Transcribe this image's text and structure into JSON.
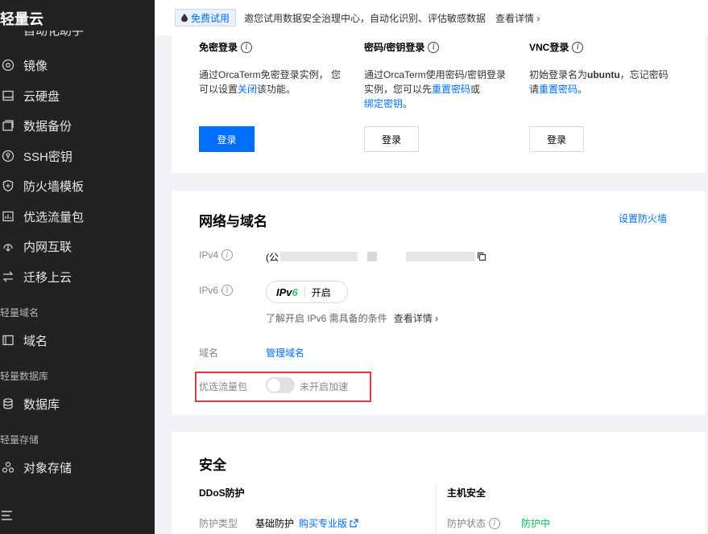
{
  "sidebar": {
    "brand": "轻量云",
    "cut_item": "自动化助手",
    "items": [
      {
        "label": "镜像",
        "icon": "image-icon"
      },
      {
        "label": "云硬盘",
        "icon": "disk-icon"
      },
      {
        "label": "数据备份",
        "icon": "backup-icon"
      },
      {
        "label": "SSH密钥",
        "icon": "key-icon"
      },
      {
        "label": "防火墙模板",
        "icon": "shield-icon"
      },
      {
        "label": "优选流量包",
        "icon": "traffic-icon"
      },
      {
        "label": "内网互联",
        "icon": "network-icon"
      },
      {
        "label": "迁移上云",
        "icon": "migrate-icon"
      }
    ],
    "section_domain": "轻量域名",
    "domain_item": "域名",
    "section_db": "轻量数据库",
    "db_item": "数据库",
    "section_storage": "轻量存储",
    "storage_item": "对象存储"
  },
  "banner": {
    "badge": "免费试用",
    "text": "邀您试用数据安全治理中心，自动化识别、评估敏感数据",
    "link": "查看详情 ›"
  },
  "login": {
    "cols": [
      {
        "title": "免密登录",
        "desc_1": "通过OrcaTerm免密登录实例，  您",
        "desc_2a": "可以设置",
        "desc_2link": "关闭",
        "desc_2b": "该功能。",
        "button": "登录"
      },
      {
        "title": "密码/密钥登录",
        "desc_1": "通过OrcaTerm使用密码/密钥登录",
        "desc_2a": "实例，您可以先",
        "desc_2link": "重置密码",
        "desc_2b": "或",
        "desc_3link": "绑定密钥",
        "desc_3b": "。",
        "button": "登录"
      },
      {
        "title": "VNC登录",
        "desc_1a": "初始登录名为",
        "desc_1bold": "ubuntu",
        "desc_1b": "，忘记密码",
        "desc_2a": "请",
        "desc_2link": "重置密码",
        "desc_2b": "。",
        "button": "登录"
      }
    ]
  },
  "network": {
    "title": "网络与域名",
    "firewall_link": "设置防火墙",
    "ipv4_label": "IPv4",
    "ipv4_prefix": "(公",
    "ipv6_label": "IPv6",
    "ipv6_logo_a": "IPv",
    "ipv6_logo_b": "6",
    "ipv6_action": "开启",
    "ipv6_hint": "了解开启 IPv6 需具备的条件",
    "ipv6_more": "查看详情 ›",
    "domain_label": "域名",
    "domain_link": "管理域名",
    "traffic_label": "优选流量包",
    "traffic_status": "未开启加速"
  },
  "security": {
    "title": "安全",
    "ddos_title": "DDoS防护",
    "ddos_type_label": "防护类型",
    "ddos_type_value": "基础防护",
    "ddos_buy_link": "购买专业版",
    "host_title": "主机安全",
    "host_status_label": "防护状态",
    "host_status_value": "防护中"
  },
  "colors": {
    "accent": "#006eff",
    "sidebar_bg": "#222222",
    "highlight": "#e5383b",
    "success": "#0abf5b"
  }
}
